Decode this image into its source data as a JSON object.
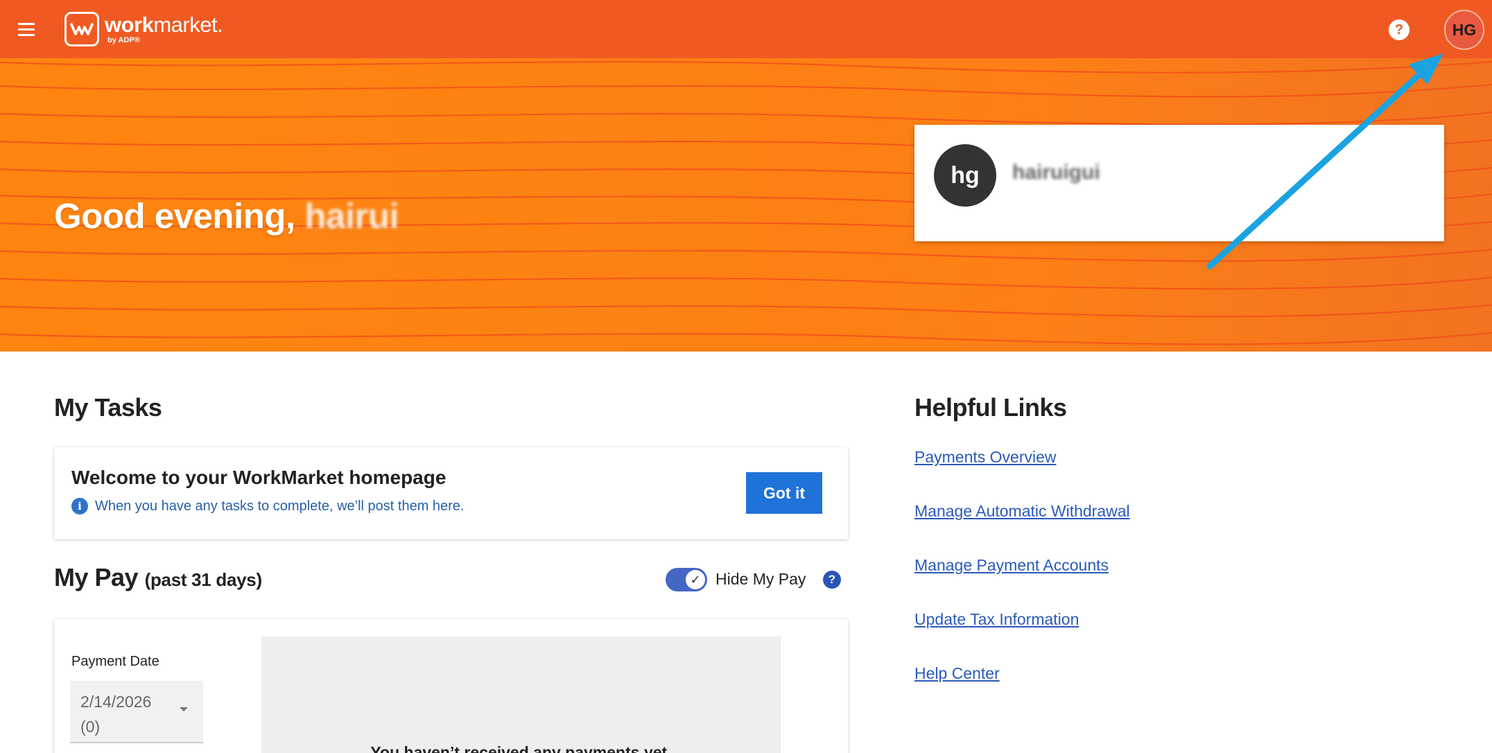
{
  "topbar": {
    "logo": {
      "word_bold": "work",
      "word_light": "market",
      "tm": ".",
      "sub": "by ADP®"
    },
    "help_label": "?",
    "avatar_initials": "HG"
  },
  "hero": {
    "greeting_prefix": "Good evening, ",
    "greeting_name": "hairui",
    "profile": {
      "initials": "hg",
      "name": "hairuigui"
    }
  },
  "tasks": {
    "title": "My Tasks",
    "welcome": "Welcome to your WorkMarket homepage",
    "info_icon": "i",
    "info_text": "When you have any tasks to complete, we’ll post them here.",
    "got_it_label": "Got it"
  },
  "pay": {
    "title": "My Pay",
    "subtitle": "(past 31 days)",
    "toggle_check": "✓",
    "toggle_label": "Hide My Pay",
    "help_label": "?",
    "date_label": "Payment Date",
    "date_value_line1": "2/14/2026",
    "date_value_line2": "(0)",
    "empty_message": "You haven’t received any payments yet."
  },
  "helpful_links": {
    "title": "Helpful Links",
    "items": [
      {
        "label": "Payments Overview"
      },
      {
        "label": "Manage Automatic Withdrawal"
      },
      {
        "label": "Manage Payment Accounts"
      },
      {
        "label": "Update Tax Information"
      },
      {
        "label": "Help Center"
      }
    ]
  },
  "colors": {
    "topbar": "#f05a22",
    "hero": "#ff8510",
    "primary_button": "#1f72d8",
    "link": "#2b5ab8",
    "annotation_arrow": "#1aa3e0"
  }
}
